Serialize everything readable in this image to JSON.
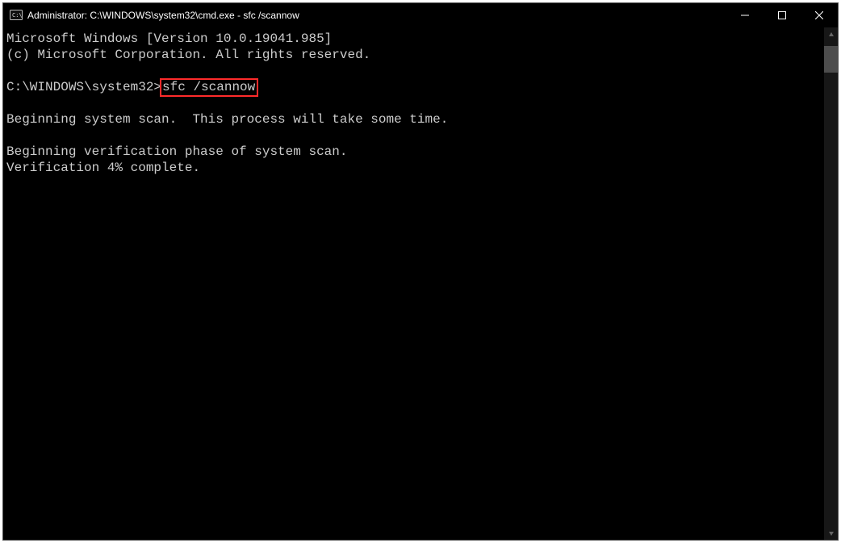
{
  "titlebar": {
    "title": "Administrator: C:\\WINDOWS\\system32\\cmd.exe - sfc  /scannow"
  },
  "console": {
    "lines": [
      "Microsoft Windows [Version 10.0.19041.985]",
      "(c) Microsoft Corporation. All rights reserved.",
      "",
      {
        "prompt": "C:\\WINDOWS\\system32>",
        "highlight": "sfc /scannow"
      },
      "",
      "Beginning system scan.  This process will take some time.",
      "",
      "Beginning verification phase of system scan.",
      "Verification 4% complete."
    ]
  },
  "scrollbar": {
    "thumb_top_pct": 1,
    "thumb_height_pct": 5.5
  }
}
